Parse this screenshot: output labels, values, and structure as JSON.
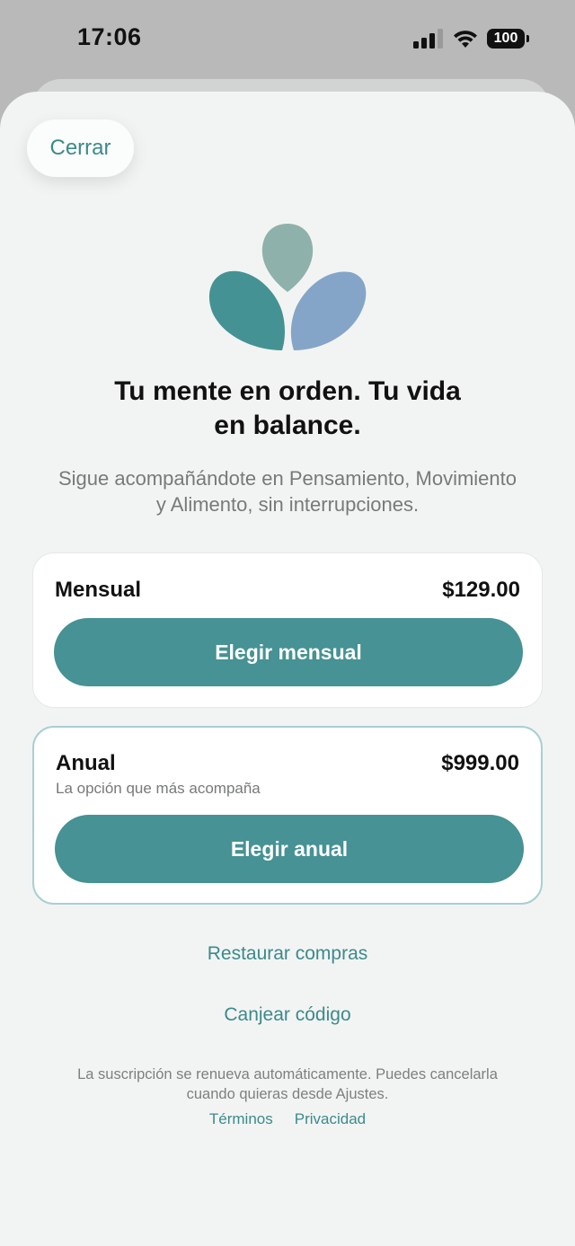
{
  "status_bar": {
    "time": "17:06",
    "battery": "100"
  },
  "header": {
    "close_label": "Cerrar"
  },
  "hero": {
    "headline_line1": "Tu mente en orden. Tu vida",
    "headline_line2": "en balance.",
    "subtitle_line1": "Sigue acompañándote en Pensamiento, Movimiento",
    "subtitle_line2": "y Alimento, sin interrupciones."
  },
  "plans": [
    {
      "name": "Mensual",
      "price": "$129.00",
      "note": "",
      "button_label": "Elegir mensual"
    },
    {
      "name": "Anual",
      "price": "$999.00",
      "note": "La opción que más acompaña",
      "button_label": "Elegir anual"
    }
  ],
  "links": {
    "restore": "Restaurar compras",
    "redeem": "Canjear código"
  },
  "legal": {
    "line1": "La suscripción se renueva automáticamente. Puedes cancelarla",
    "line2": "cuando quieras desde Ajustes.",
    "terms": "Términos",
    "privacy": "Privacidad"
  },
  "colors": {
    "accent": "#469294",
    "link": "#3c8a8b",
    "logo_top": "#8fb1ab",
    "logo_left": "#459294",
    "logo_right": "#84a5c8",
    "sheet_bg": "#f2f4f3"
  },
  "icons": [
    "signal-icon",
    "wifi-icon",
    "battery-icon",
    "logo-icon"
  ]
}
